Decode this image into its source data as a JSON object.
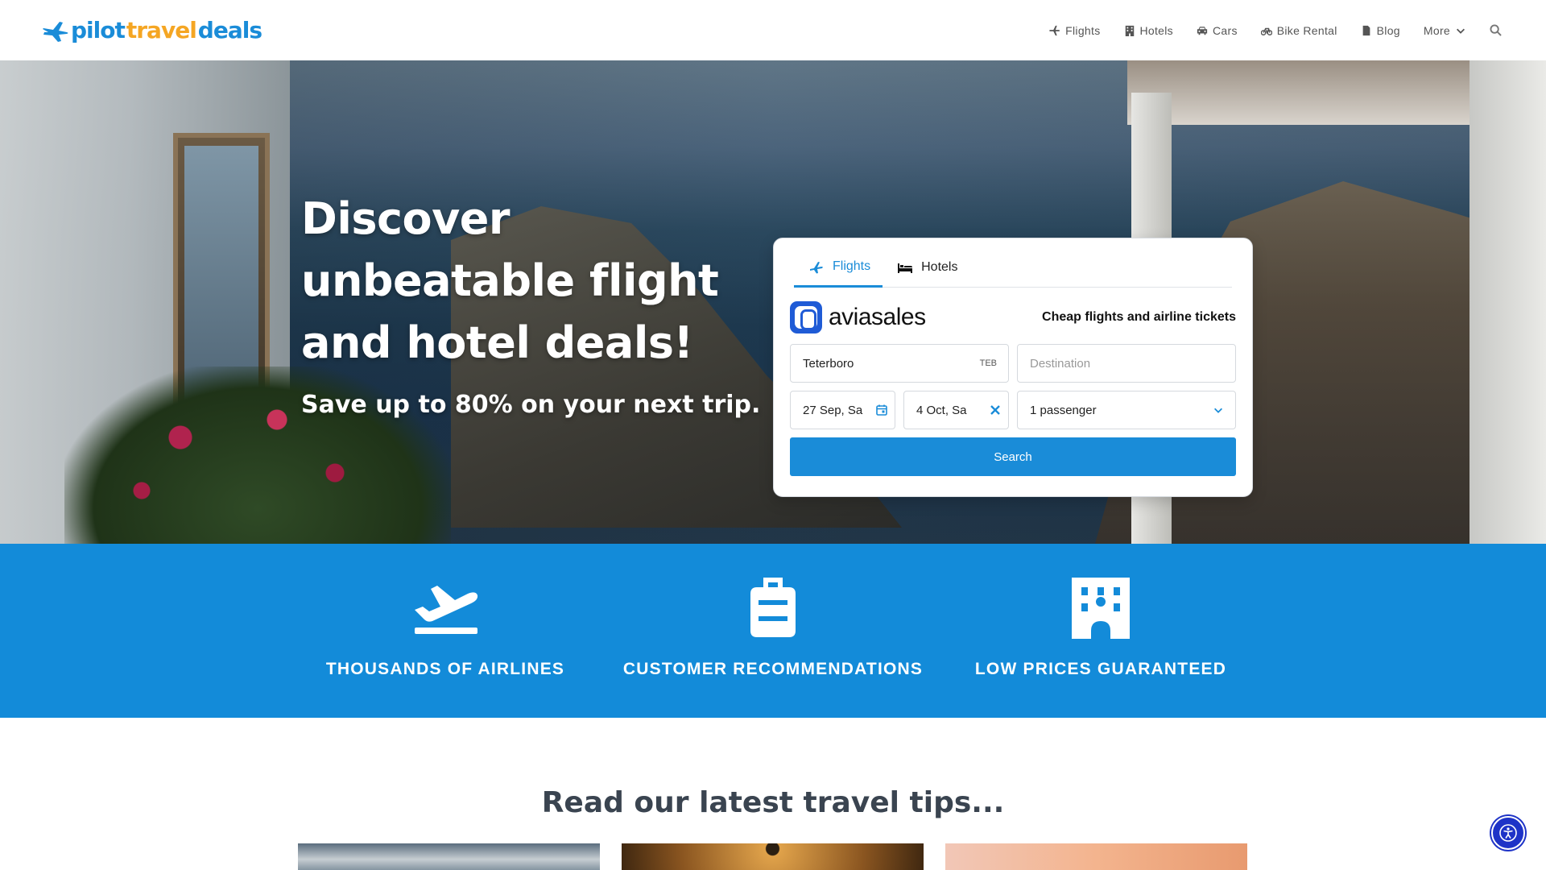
{
  "header": {
    "logo_part1": "pilot",
    "logo_part2": "travel",
    "logo_part3": "deals",
    "nav": [
      {
        "label": "Flights",
        "icon": "plane-icon"
      },
      {
        "label": "Hotels",
        "icon": "building-icon"
      },
      {
        "label": "Cars",
        "icon": "car-icon"
      },
      {
        "label": "Bike Rental",
        "icon": "bike-icon"
      },
      {
        "label": "Blog",
        "icon": "document-icon"
      },
      {
        "label": "More",
        "icon": "chevron-down-icon"
      }
    ]
  },
  "hero": {
    "title": "Discover unbeatable flight and hotel deals!",
    "subtitle": "Save up to 80% on your next trip."
  },
  "widget": {
    "tabs": [
      {
        "label": "Flights",
        "active": true
      },
      {
        "label": "Hotels",
        "active": false
      }
    ],
    "brand": "aviasales",
    "tagline": "Cheap flights and airline tickets",
    "origin": {
      "value": "Teterboro",
      "code": "TEB"
    },
    "destination": {
      "placeholder": "Destination"
    },
    "depart_date": "27 Sep, Sa",
    "return_date": "4 Oct, Sa",
    "passengers": "1 passenger",
    "search_label": "Search"
  },
  "features": [
    {
      "label": "THOUSANDS OF AIRLINES",
      "icon": "plane-departure-icon"
    },
    {
      "label": "CUSTOMER RECOMMENDATIONS",
      "icon": "suitcase-icon"
    },
    {
      "label": "LOW PRICES GUARANTEED",
      "icon": "hotel-icon"
    }
  ],
  "tips": {
    "title": "Read our latest travel tips..."
  },
  "colors": {
    "accent": "#1a8cd8",
    "logo_orange": "#f5a623",
    "band": "#138bd9",
    "a11y": "#1e33c7"
  }
}
